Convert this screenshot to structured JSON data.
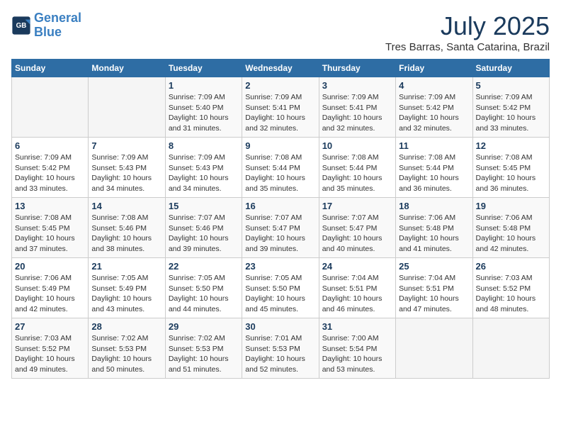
{
  "header": {
    "logo_line1": "General",
    "logo_line2": "Blue",
    "month_year": "July 2025",
    "location": "Tres Barras, Santa Catarina, Brazil"
  },
  "weekdays": [
    "Sunday",
    "Monday",
    "Tuesday",
    "Wednesday",
    "Thursday",
    "Friday",
    "Saturday"
  ],
  "weeks": [
    [
      {
        "day": "",
        "info": ""
      },
      {
        "day": "",
        "info": ""
      },
      {
        "day": "1",
        "info": "Sunrise: 7:09 AM\nSunset: 5:40 PM\nDaylight: 10 hours\nand 31 minutes."
      },
      {
        "day": "2",
        "info": "Sunrise: 7:09 AM\nSunset: 5:41 PM\nDaylight: 10 hours\nand 32 minutes."
      },
      {
        "day": "3",
        "info": "Sunrise: 7:09 AM\nSunset: 5:41 PM\nDaylight: 10 hours\nand 32 minutes."
      },
      {
        "day": "4",
        "info": "Sunrise: 7:09 AM\nSunset: 5:42 PM\nDaylight: 10 hours\nand 32 minutes."
      },
      {
        "day": "5",
        "info": "Sunrise: 7:09 AM\nSunset: 5:42 PM\nDaylight: 10 hours\nand 33 minutes."
      }
    ],
    [
      {
        "day": "6",
        "info": "Sunrise: 7:09 AM\nSunset: 5:42 PM\nDaylight: 10 hours\nand 33 minutes."
      },
      {
        "day": "7",
        "info": "Sunrise: 7:09 AM\nSunset: 5:43 PM\nDaylight: 10 hours\nand 34 minutes."
      },
      {
        "day": "8",
        "info": "Sunrise: 7:09 AM\nSunset: 5:43 PM\nDaylight: 10 hours\nand 34 minutes."
      },
      {
        "day": "9",
        "info": "Sunrise: 7:08 AM\nSunset: 5:44 PM\nDaylight: 10 hours\nand 35 minutes."
      },
      {
        "day": "10",
        "info": "Sunrise: 7:08 AM\nSunset: 5:44 PM\nDaylight: 10 hours\nand 35 minutes."
      },
      {
        "day": "11",
        "info": "Sunrise: 7:08 AM\nSunset: 5:44 PM\nDaylight: 10 hours\nand 36 minutes."
      },
      {
        "day": "12",
        "info": "Sunrise: 7:08 AM\nSunset: 5:45 PM\nDaylight: 10 hours\nand 36 minutes."
      }
    ],
    [
      {
        "day": "13",
        "info": "Sunrise: 7:08 AM\nSunset: 5:45 PM\nDaylight: 10 hours\nand 37 minutes."
      },
      {
        "day": "14",
        "info": "Sunrise: 7:08 AM\nSunset: 5:46 PM\nDaylight: 10 hours\nand 38 minutes."
      },
      {
        "day": "15",
        "info": "Sunrise: 7:07 AM\nSunset: 5:46 PM\nDaylight: 10 hours\nand 39 minutes."
      },
      {
        "day": "16",
        "info": "Sunrise: 7:07 AM\nSunset: 5:47 PM\nDaylight: 10 hours\nand 39 minutes."
      },
      {
        "day": "17",
        "info": "Sunrise: 7:07 AM\nSunset: 5:47 PM\nDaylight: 10 hours\nand 40 minutes."
      },
      {
        "day": "18",
        "info": "Sunrise: 7:06 AM\nSunset: 5:48 PM\nDaylight: 10 hours\nand 41 minutes."
      },
      {
        "day": "19",
        "info": "Sunrise: 7:06 AM\nSunset: 5:48 PM\nDaylight: 10 hours\nand 42 minutes."
      }
    ],
    [
      {
        "day": "20",
        "info": "Sunrise: 7:06 AM\nSunset: 5:49 PM\nDaylight: 10 hours\nand 42 minutes."
      },
      {
        "day": "21",
        "info": "Sunrise: 7:05 AM\nSunset: 5:49 PM\nDaylight: 10 hours\nand 43 minutes."
      },
      {
        "day": "22",
        "info": "Sunrise: 7:05 AM\nSunset: 5:50 PM\nDaylight: 10 hours\nand 44 minutes."
      },
      {
        "day": "23",
        "info": "Sunrise: 7:05 AM\nSunset: 5:50 PM\nDaylight: 10 hours\nand 45 minutes."
      },
      {
        "day": "24",
        "info": "Sunrise: 7:04 AM\nSunset: 5:51 PM\nDaylight: 10 hours\nand 46 minutes."
      },
      {
        "day": "25",
        "info": "Sunrise: 7:04 AM\nSunset: 5:51 PM\nDaylight: 10 hours\nand 47 minutes."
      },
      {
        "day": "26",
        "info": "Sunrise: 7:03 AM\nSunset: 5:52 PM\nDaylight: 10 hours\nand 48 minutes."
      }
    ],
    [
      {
        "day": "27",
        "info": "Sunrise: 7:03 AM\nSunset: 5:52 PM\nDaylight: 10 hours\nand 49 minutes."
      },
      {
        "day": "28",
        "info": "Sunrise: 7:02 AM\nSunset: 5:53 PM\nDaylight: 10 hours\nand 50 minutes."
      },
      {
        "day": "29",
        "info": "Sunrise: 7:02 AM\nSunset: 5:53 PM\nDaylight: 10 hours\nand 51 minutes."
      },
      {
        "day": "30",
        "info": "Sunrise: 7:01 AM\nSunset: 5:53 PM\nDaylight: 10 hours\nand 52 minutes."
      },
      {
        "day": "31",
        "info": "Sunrise: 7:00 AM\nSunset: 5:54 PM\nDaylight: 10 hours\nand 53 minutes."
      },
      {
        "day": "",
        "info": ""
      },
      {
        "day": "",
        "info": ""
      }
    ]
  ]
}
